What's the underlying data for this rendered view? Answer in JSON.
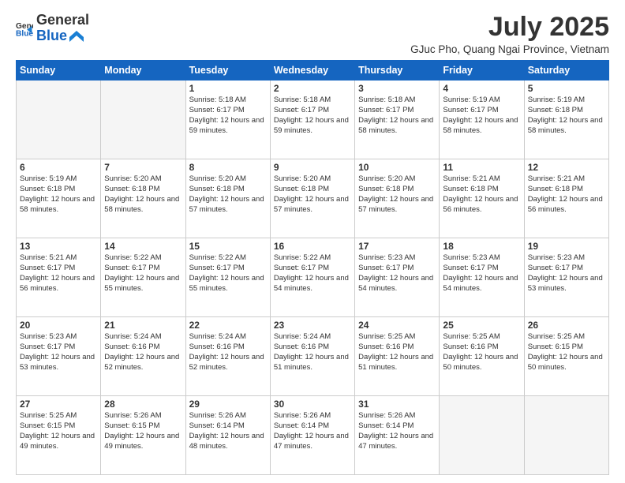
{
  "header": {
    "logo_general": "General",
    "logo_blue": "Blue",
    "month_title": "July 2025",
    "location": "GJuc Pho, Quang Ngai Province, Vietnam"
  },
  "weekdays": [
    "Sunday",
    "Monday",
    "Tuesday",
    "Wednesday",
    "Thursday",
    "Friday",
    "Saturday"
  ],
  "weeks": [
    [
      {
        "day": "",
        "info": ""
      },
      {
        "day": "",
        "info": ""
      },
      {
        "day": "1",
        "info": "Sunrise: 5:18 AM\nSunset: 6:17 PM\nDaylight: 12 hours and 59 minutes."
      },
      {
        "day": "2",
        "info": "Sunrise: 5:18 AM\nSunset: 6:17 PM\nDaylight: 12 hours and 59 minutes."
      },
      {
        "day": "3",
        "info": "Sunrise: 5:18 AM\nSunset: 6:17 PM\nDaylight: 12 hours and 58 minutes."
      },
      {
        "day": "4",
        "info": "Sunrise: 5:19 AM\nSunset: 6:17 PM\nDaylight: 12 hours and 58 minutes."
      },
      {
        "day": "5",
        "info": "Sunrise: 5:19 AM\nSunset: 6:18 PM\nDaylight: 12 hours and 58 minutes."
      }
    ],
    [
      {
        "day": "6",
        "info": "Sunrise: 5:19 AM\nSunset: 6:18 PM\nDaylight: 12 hours and 58 minutes."
      },
      {
        "day": "7",
        "info": "Sunrise: 5:20 AM\nSunset: 6:18 PM\nDaylight: 12 hours and 58 minutes."
      },
      {
        "day": "8",
        "info": "Sunrise: 5:20 AM\nSunset: 6:18 PM\nDaylight: 12 hours and 57 minutes."
      },
      {
        "day": "9",
        "info": "Sunrise: 5:20 AM\nSunset: 6:18 PM\nDaylight: 12 hours and 57 minutes."
      },
      {
        "day": "10",
        "info": "Sunrise: 5:20 AM\nSunset: 6:18 PM\nDaylight: 12 hours and 57 minutes."
      },
      {
        "day": "11",
        "info": "Sunrise: 5:21 AM\nSunset: 6:18 PM\nDaylight: 12 hours and 56 minutes."
      },
      {
        "day": "12",
        "info": "Sunrise: 5:21 AM\nSunset: 6:18 PM\nDaylight: 12 hours and 56 minutes."
      }
    ],
    [
      {
        "day": "13",
        "info": "Sunrise: 5:21 AM\nSunset: 6:17 PM\nDaylight: 12 hours and 56 minutes."
      },
      {
        "day": "14",
        "info": "Sunrise: 5:22 AM\nSunset: 6:17 PM\nDaylight: 12 hours and 55 minutes."
      },
      {
        "day": "15",
        "info": "Sunrise: 5:22 AM\nSunset: 6:17 PM\nDaylight: 12 hours and 55 minutes."
      },
      {
        "day": "16",
        "info": "Sunrise: 5:22 AM\nSunset: 6:17 PM\nDaylight: 12 hours and 54 minutes."
      },
      {
        "day": "17",
        "info": "Sunrise: 5:23 AM\nSunset: 6:17 PM\nDaylight: 12 hours and 54 minutes."
      },
      {
        "day": "18",
        "info": "Sunrise: 5:23 AM\nSunset: 6:17 PM\nDaylight: 12 hours and 54 minutes."
      },
      {
        "day": "19",
        "info": "Sunrise: 5:23 AM\nSunset: 6:17 PM\nDaylight: 12 hours and 53 minutes."
      }
    ],
    [
      {
        "day": "20",
        "info": "Sunrise: 5:23 AM\nSunset: 6:17 PM\nDaylight: 12 hours and 53 minutes."
      },
      {
        "day": "21",
        "info": "Sunrise: 5:24 AM\nSunset: 6:16 PM\nDaylight: 12 hours and 52 minutes."
      },
      {
        "day": "22",
        "info": "Sunrise: 5:24 AM\nSunset: 6:16 PM\nDaylight: 12 hours and 52 minutes."
      },
      {
        "day": "23",
        "info": "Sunrise: 5:24 AM\nSunset: 6:16 PM\nDaylight: 12 hours and 51 minutes."
      },
      {
        "day": "24",
        "info": "Sunrise: 5:25 AM\nSunset: 6:16 PM\nDaylight: 12 hours and 51 minutes."
      },
      {
        "day": "25",
        "info": "Sunrise: 5:25 AM\nSunset: 6:16 PM\nDaylight: 12 hours and 50 minutes."
      },
      {
        "day": "26",
        "info": "Sunrise: 5:25 AM\nSunset: 6:15 PM\nDaylight: 12 hours and 50 minutes."
      }
    ],
    [
      {
        "day": "27",
        "info": "Sunrise: 5:25 AM\nSunset: 6:15 PM\nDaylight: 12 hours and 49 minutes."
      },
      {
        "day": "28",
        "info": "Sunrise: 5:26 AM\nSunset: 6:15 PM\nDaylight: 12 hours and 49 minutes."
      },
      {
        "day": "29",
        "info": "Sunrise: 5:26 AM\nSunset: 6:14 PM\nDaylight: 12 hours and 48 minutes."
      },
      {
        "day": "30",
        "info": "Sunrise: 5:26 AM\nSunset: 6:14 PM\nDaylight: 12 hours and 47 minutes."
      },
      {
        "day": "31",
        "info": "Sunrise: 5:26 AM\nSunset: 6:14 PM\nDaylight: 12 hours and 47 minutes."
      },
      {
        "day": "",
        "info": ""
      },
      {
        "day": "",
        "info": ""
      }
    ]
  ]
}
